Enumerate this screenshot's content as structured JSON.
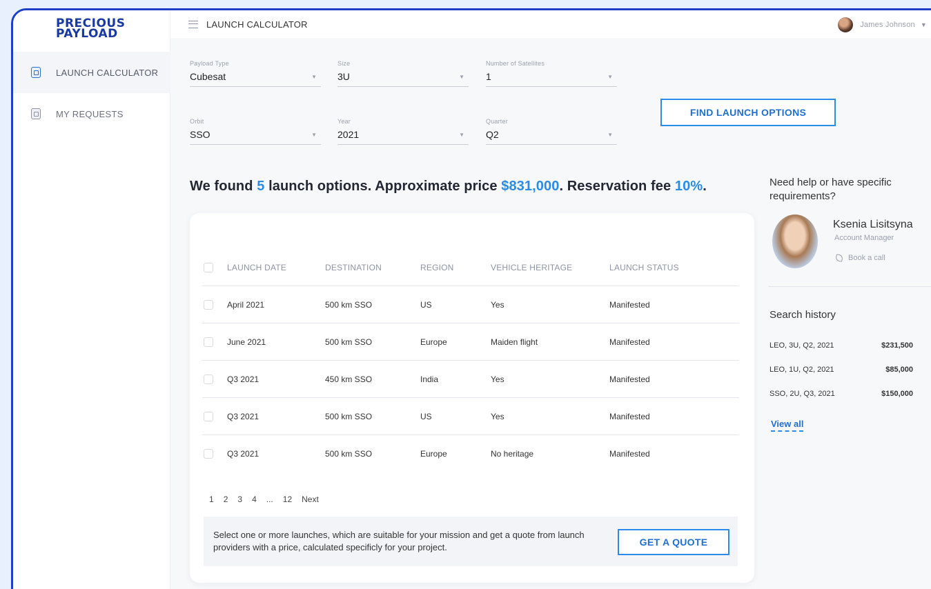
{
  "brand": {
    "line1": "PRECIOUS",
    "line2": "PAYLOAD"
  },
  "sidebar": {
    "items": [
      {
        "label": "LAUNCH CALCULATOR",
        "icon": "calculator-doc-icon",
        "active": true
      },
      {
        "label": "MY REQUESTS",
        "icon": "requests-doc-icon",
        "active": false
      }
    ]
  },
  "topbar": {
    "title": "LAUNCH CALCULATOR",
    "user_name": "James Johnson"
  },
  "filters": {
    "payload_type": {
      "label": "Payload Type",
      "value": "Cubesat"
    },
    "size": {
      "label": "Size",
      "value": "3U"
    },
    "satellites": {
      "label": "Number of Satellites",
      "value": "1"
    },
    "orbit": {
      "label": "Orbit",
      "value": "SSO"
    },
    "year": {
      "label": "Year",
      "value": "2021"
    },
    "quarter": {
      "label": "Quarter",
      "value": "Q2"
    },
    "find_button": "FIND LAUNCH OPTIONS"
  },
  "summary": {
    "p1": "We found ",
    "count": "5",
    "p2": " launch options. Approximate price ",
    "price": "$831,000",
    "p3": ". Reservation fee ",
    "fee": "10%",
    "p4": "."
  },
  "table": {
    "headers": [
      "LAUNCH DATE",
      "DESTINATION",
      "REGION",
      "VEHICLE HERITAGE",
      "LAUNCH STATUS"
    ],
    "rows": [
      [
        "April 2021",
        "500 km SSO",
        "US",
        "Yes",
        "Manifested"
      ],
      [
        "June 2021",
        "500 km SSO",
        "Europe",
        "Maiden flight",
        "Manifested"
      ],
      [
        "Q3 2021",
        "450 km SSO",
        "India",
        "Yes",
        "Manifested"
      ],
      [
        "Q3 2021",
        "500 km SSO",
        "US",
        "Yes",
        "Manifested"
      ],
      [
        "Q3 2021",
        "500 km SSO",
        "Europe",
        "No heritage",
        "Manifested"
      ]
    ]
  },
  "pagination": {
    "pages": [
      "1",
      "2",
      "3",
      "4",
      "...",
      "12"
    ],
    "next": "Next"
  },
  "quote": {
    "text": "Select one or more launches, which are suitable for your mission and get a quote from launch providers with a price, calculated specificly for your project.",
    "button": "GET A QUOTE"
  },
  "help": {
    "title": "Need help or have specific requirements?",
    "manager_name": "Ksenia Lisitsyna",
    "manager_role": "Account Manager",
    "book_call": "Book a call"
  },
  "search_history": {
    "title": "Search history",
    "items": [
      {
        "query": "LEO, 3U, Q2, 2021",
        "price": "$231,500"
      },
      {
        "query": "LEO, 1U, Q2, 2021",
        "price": "$85,000"
      },
      {
        "query": "SSO, 2U, Q3, 2021",
        "price": "$150,000"
      }
    ],
    "view_all": "View all"
  },
  "colors": {
    "accent": "#2b8be8",
    "frame": "#1e3ec8",
    "brand": "#1a3aa0"
  }
}
